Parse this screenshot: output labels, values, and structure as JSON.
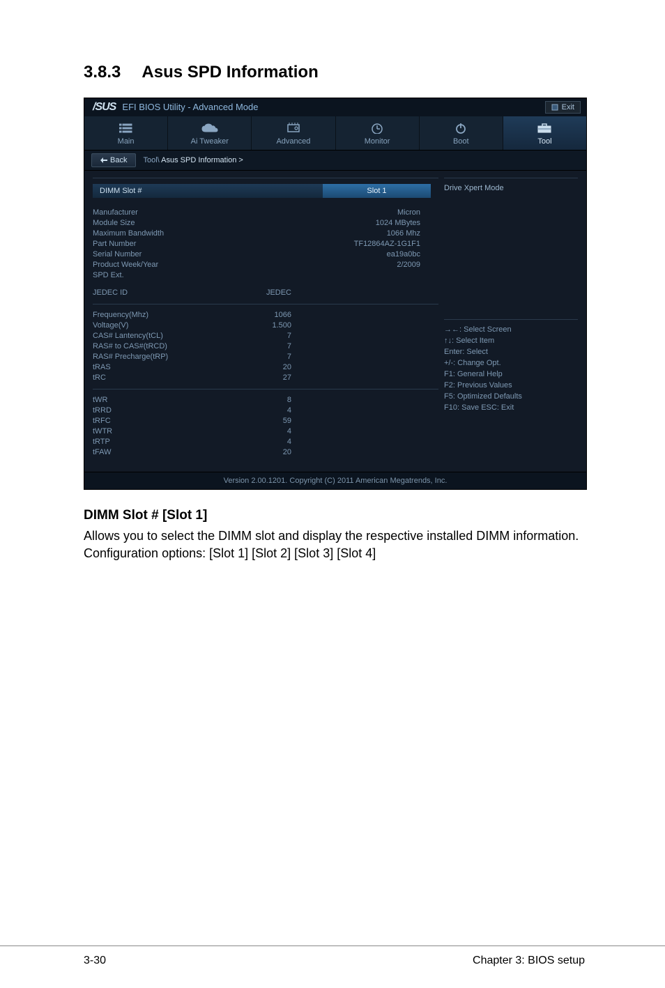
{
  "section": {
    "number": "3.8.3",
    "title": "Asus SPD Information"
  },
  "bios": {
    "logo": "/SUS",
    "title": "EFI BIOS Utility - Advanced Mode",
    "exit": "Exit",
    "tabs": {
      "main": "Main",
      "ai_tweaker": "Ai Tweaker",
      "advanced": "Advanced",
      "monitor": "Monitor",
      "boot": "Boot",
      "tool": "Tool"
    },
    "back": "Back",
    "breadcrumb_prefix": "Tool\\ ",
    "breadcrumb_current": "Asus SPD Information  >",
    "dimm_slot_label": "DIMM Slot #",
    "dimm_slot_value": "Slot 1",
    "rows1": [
      {
        "label": "Manufacturer",
        "value": "Micron"
      },
      {
        "label": "Module Size",
        "value": "1024 MBytes"
      },
      {
        "label": "Maximum Bandwidth",
        "value": "1066 Mhz"
      },
      {
        "label": "Part Number",
        "value": "TF12864AZ-1G1F1"
      },
      {
        "label": "Serial Number",
        "value": "ea19a0bc"
      },
      {
        "label": "Product Week/Year",
        "value": "2/2009"
      },
      {
        "label": "SPD Ext.",
        "value": ""
      }
    ],
    "jedec_label": "JEDEC ID",
    "jedec_value": "JEDEC",
    "rows2": [
      {
        "label": "Frequency(Mhz)",
        "value": "1066"
      },
      {
        "label": "Voltage(V)",
        "value": "1.500"
      },
      {
        "label": "CAS# Lantency(tCL)",
        "value": "7"
      },
      {
        "label": "RAS# to CAS#(tRCD)",
        "value": "7"
      },
      {
        "label": "RAS# Precharge(tRP)",
        "value": "7"
      },
      {
        "label": "tRAS",
        "value": "20"
      },
      {
        "label": "tRC",
        "value": "27"
      }
    ],
    "rows3": [
      {
        "label": "tWR",
        "value": "8"
      },
      {
        "label": "tRRD",
        "value": "4"
      },
      {
        "label": "tRFC",
        "value": "59"
      },
      {
        "label": "tWTR",
        "value": "4"
      },
      {
        "label": "tRTP",
        "value": "4"
      },
      {
        "label": "tFAW",
        "value": "20"
      }
    ],
    "right_title": "Drive Xpert Mode",
    "help": [
      "→←: Select Screen",
      "↑↓: Select Item",
      "Enter: Select",
      "+/-: Change Opt.",
      "F1: General Help",
      "F2: Previous Values",
      "F5: Optimized Defaults",
      "F10: Save   ESC: Exit"
    ],
    "footer_version": "Version 2.00.1201.   Copyright (C) 2011 American Megatrends, Inc."
  },
  "subsection": {
    "heading": "DIMM Slot # [Slot 1]",
    "body": "Allows you to select the DIMM slot and display the respective installed DIMM information. Configuration options: [Slot 1] [Slot 2] [Slot 3] [Slot 4]"
  },
  "page_footer": {
    "left": "3-30",
    "right": "Chapter 3: BIOS setup"
  }
}
